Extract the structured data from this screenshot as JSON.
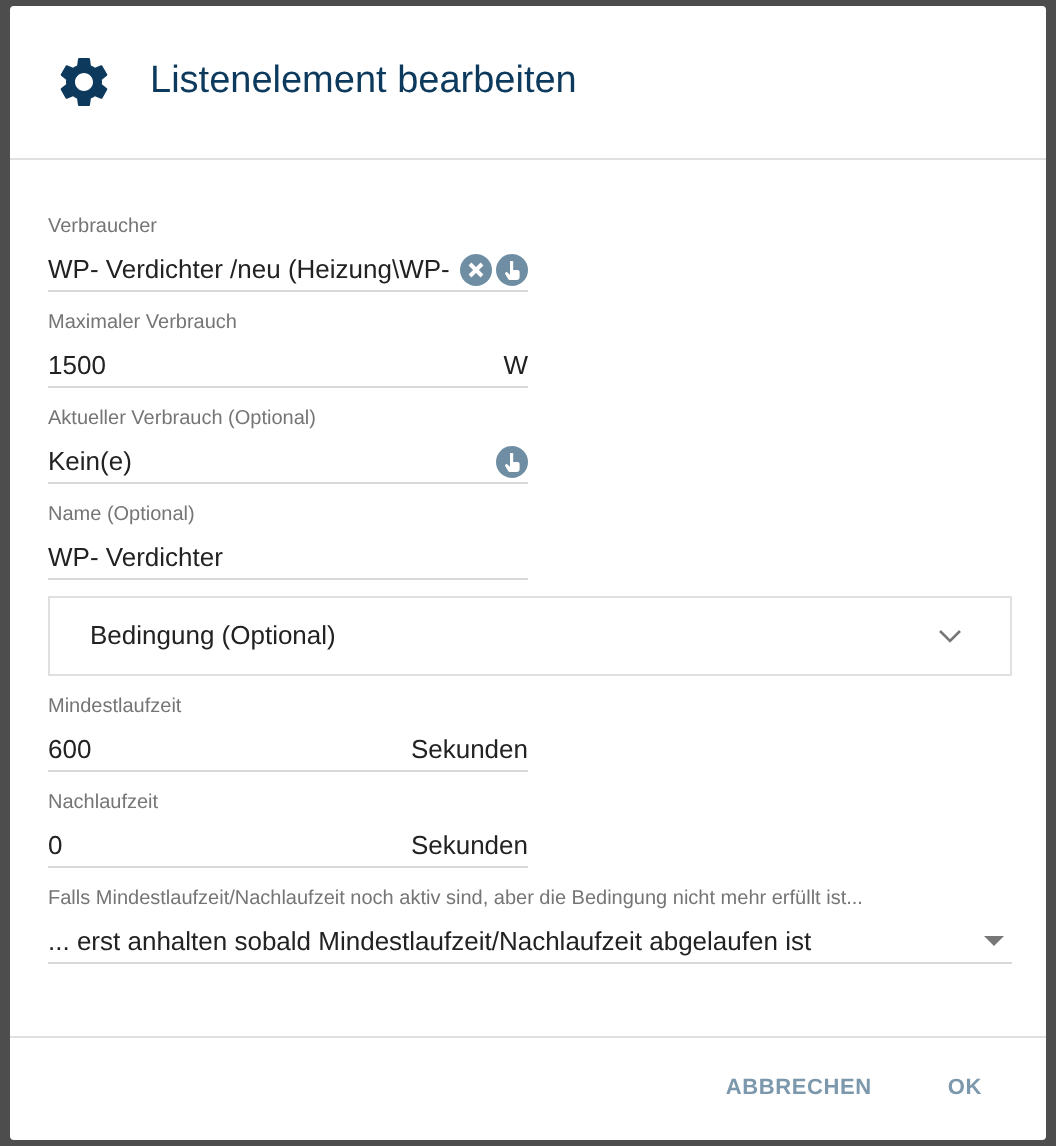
{
  "dialog": {
    "title": "Listenelement bearbeiten",
    "fields": [
      {
        "kind": "text",
        "label": "Verbraucher",
        "value": "WP- Verdichter /neu (Heizung\\WP- ",
        "clearable": true,
        "picker": true
      },
      {
        "kind": "text",
        "label": "Maximaler Verbrauch",
        "value": "1500",
        "unit": "W",
        "clearable": false,
        "picker": false
      },
      {
        "kind": "text",
        "label": "Aktueller Verbrauch (Optional)",
        "value": "Kein(e)",
        "clearable": false,
        "picker": true
      },
      {
        "kind": "text",
        "label": "Name (Optional)",
        "value": "WP- Verdichter",
        "clearable": false,
        "picker": false
      },
      {
        "kind": "accordion",
        "label": "Bedingung (Optional)",
        "expanded": false
      },
      {
        "kind": "text",
        "label": "Mindestlaufzeit",
        "value": "600",
        "unit": "Sekunden",
        "clearable": false,
        "picker": false
      },
      {
        "kind": "text",
        "label": "Nachlaufzeit",
        "value": "0",
        "unit": "Sekunden",
        "clearable": false,
        "picker": false
      },
      {
        "kind": "select",
        "label": "Falls Mindestlaufzeit/Nachlaufzeit noch aktiv sind, aber die Bedingung nicht mehr erfüllt ist...",
        "value": "... erst anhalten sobald Mindestlaufzeit/Nachlaufzeit abgelaufen ist"
      }
    ],
    "buttons": [
      "ABBRECHEN",
      "OK"
    ]
  }
}
